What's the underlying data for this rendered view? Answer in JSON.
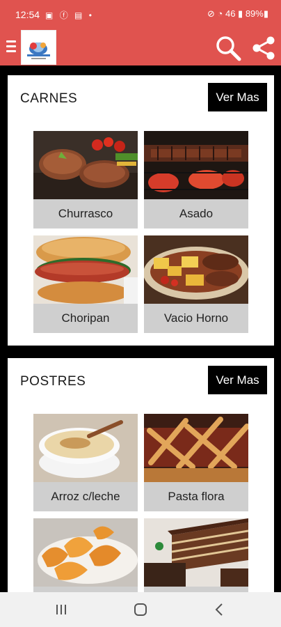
{
  "statusbar": {
    "time": "12:54",
    "icons_left": "▣ ⓕ ▤ •",
    "right_text": "⊘ ◔ 46 ▮ 89%▮"
  },
  "header": {
    "menu_icon": "hamburger-menu-icon",
    "logo_icon": "app-logo",
    "search_icon": "search-icon",
    "share_icon": "share-icon"
  },
  "sections": [
    {
      "title": "CARNES",
      "more_label": "Ver Mas",
      "items": [
        {
          "label": "Churrasco"
        },
        {
          "label": "Asado"
        },
        {
          "label": "Choripan"
        },
        {
          "label": "Vacio Horno"
        }
      ]
    },
    {
      "title": "POSTRES",
      "more_label": "Ver Mas",
      "items": [
        {
          "label": "Arroz c/leche"
        },
        {
          "label": "Pasta flora"
        },
        {
          "label": ""
        },
        {
          "label": ""
        }
      ]
    }
  ],
  "navbar": {
    "recent_icon": "recent-apps-icon",
    "home_icon": "home-icon",
    "back_icon": "back-icon"
  }
}
